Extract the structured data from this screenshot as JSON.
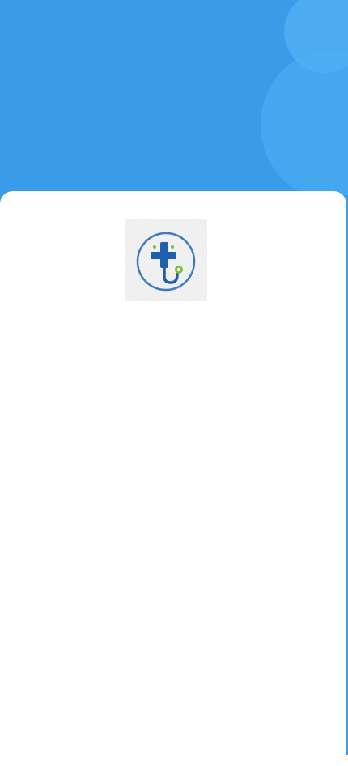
{
  "theme": {
    "header_color": "#3a9be9",
    "bubble_color": "#4eb0f5",
    "bubble_color_light": "#56b4f4",
    "card_color": "#ffffff"
  },
  "logo": {
    "icon": "medical-cross-stethoscope-icon",
    "ring_color": "#3b7cc4",
    "cross_color": "#1f5fb0",
    "accent_color": "#7bbf3a"
  }
}
